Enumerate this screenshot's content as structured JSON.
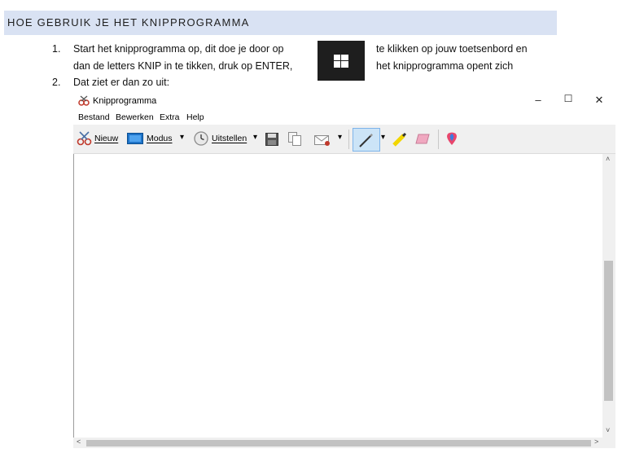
{
  "heading": "HOE GEBRUIK JE HET KNIPPROGRAMMA",
  "steps": [
    {
      "number": "1.",
      "line1_left": "Start het knipprogramma op, dit doe je door op",
      "line1_right": "te klikken op jouw toetsenbord en",
      "line2_left": "dan de letters KNIP in te tikken, druk op ENTER,",
      "line2_right": "het knipprogramma opent zich"
    },
    {
      "number": "2.",
      "line1_left": "Dat ziet er dan zo uit:"
    }
  ],
  "window": {
    "title": "Knipprogramma",
    "controls": {
      "minimize": "–",
      "maximize": "☐",
      "close": "✕"
    },
    "menu": [
      "Bestand",
      "Bewerken",
      "Extra",
      "Help"
    ],
    "toolbar": {
      "new_label": "Nieuw",
      "mode_label": "Modus",
      "delay_label": "Uitstellen",
      "dropdown_glyph": "▾"
    },
    "scroll": {
      "up": "˄",
      "down": "˅",
      "left": "<",
      "right": ">"
    }
  },
  "colors": {
    "heading_bg": "#d9e2f3",
    "windows_key_bg": "#1e1e1e",
    "pen_active_bg": "#cce4f7"
  }
}
